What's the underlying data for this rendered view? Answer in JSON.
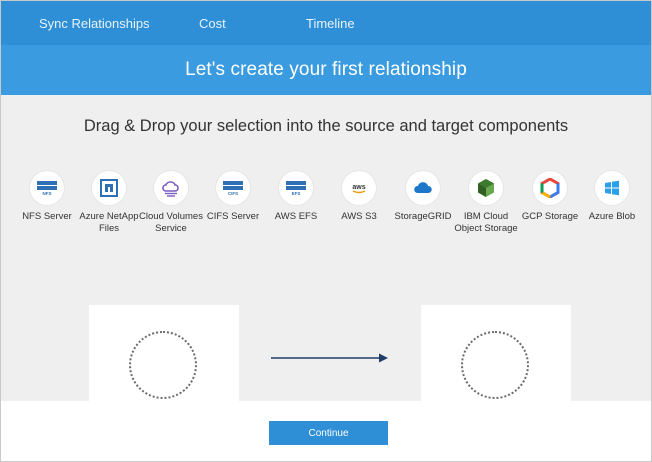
{
  "nav": {
    "items": [
      {
        "label": "Sync Relationships"
      },
      {
        "label": "Cost"
      },
      {
        "label": "Timeline"
      }
    ]
  },
  "banner": {
    "title": "Let's create your first relationship"
  },
  "main": {
    "instruction": "Drag & Drop your selection into the source and target components",
    "components": [
      {
        "label": "NFS Server",
        "icon": "nfs-server-icon",
        "badge": "NFS",
        "color": "#2f6fb5"
      },
      {
        "label": "Azure NetApp Files",
        "icon": "azure-netapp-files-icon",
        "color": "#2f6fb5"
      },
      {
        "label": "Cloud Volumes Service",
        "icon": "cloud-volumes-service-icon",
        "color": "#7a5cc2"
      },
      {
        "label": "CIFS Server",
        "icon": "cifs-server-icon",
        "badge": "CIFS",
        "color": "#2f6fb5"
      },
      {
        "label": "AWS EFS",
        "icon": "aws-efs-icon",
        "badge": "EFS",
        "color": "#2f6fb5"
      },
      {
        "label": "AWS S3",
        "icon": "aws-s3-icon",
        "badge": "aws",
        "color": "#f39c12"
      },
      {
        "label": "StorageGRID",
        "icon": "storagegrid-icon",
        "color": "#1f77c9"
      },
      {
        "label": "IBM Cloud Object Storage",
        "icon": "ibm-cloud-object-storage-icon",
        "color": "#4a8a3a"
      },
      {
        "label": "GCP Storage",
        "icon": "gcp-storage-icon",
        "color": "#e8453c"
      },
      {
        "label": "Azure Blob",
        "icon": "azure-blob-icon",
        "color": "#2aa0e8"
      }
    ]
  },
  "footer": {
    "continue_label": "Continue"
  }
}
